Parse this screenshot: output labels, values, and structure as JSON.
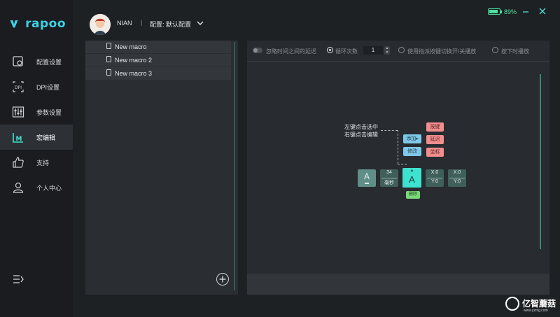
{
  "brand": {
    "logo_text": "rapoo"
  },
  "sidebar": {
    "items": [
      {
        "label": "配置设置",
        "icon": "config-settings-icon"
      },
      {
        "label": "DPI设置",
        "icon": "dpi-icon"
      },
      {
        "label": "参数设置",
        "icon": "sliders-icon"
      },
      {
        "label": "宏编辑",
        "icon": "macro-icon",
        "active": true
      },
      {
        "label": "支持",
        "icon": "thumbs-up-icon"
      },
      {
        "label": "个人中心",
        "icon": "user-icon"
      }
    ],
    "bottom_icon": "collapse-menu-icon"
  },
  "header": {
    "user_name": "NIAN",
    "separator": "|",
    "config_label": "配置: 默认配置",
    "battery_text": "89%",
    "battery_level": 0.89
  },
  "macro_list": {
    "items": [
      "New macro",
      "New macro 2",
      "New macro 3"
    ],
    "add_icon": "plus-circle-icon"
  },
  "editor": {
    "ignore_delay_label": "忽略时间之间的延迟",
    "loop_label": "循环次数",
    "loop_value": "1",
    "toggle_by_key_label": "使用指派按键切换开/关播放",
    "play_while_pressed_label": "按下时播放"
  },
  "canvas": {
    "hint_line1": "左键点击选中",
    "hint_line2": "右键点击编辑",
    "btn_add": "添加",
    "btn_add_arrow": "▸",
    "btn_modify": "修改",
    "btn_key": "按键",
    "btn_delay": "延迟",
    "btn_coord": "坐标",
    "key_a1": "A",
    "delay_value": "34",
    "delay_unit": "毫秒",
    "key_a2": "A",
    "key_a2_arrow": "▲",
    "coord1_x": "X:0",
    "coord1_y": "Y:0",
    "coord2_x": "X:0",
    "coord2_y": "Y:0",
    "btn_delete": "删除"
  },
  "watermark": {
    "text": "亿智蘑菇",
    "sub": "www.yzmg.com"
  },
  "colors": {
    "accent": "#3fd0e6",
    "highlight": "#3de3cf",
    "battery": "#4be0a0"
  }
}
